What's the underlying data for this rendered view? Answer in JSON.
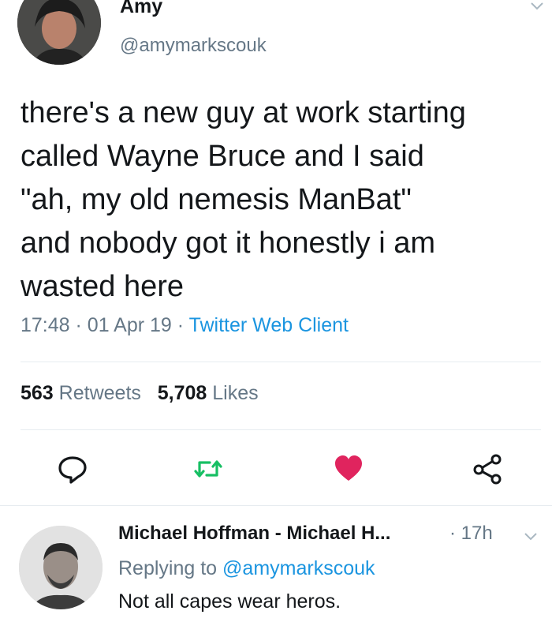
{
  "tweet": {
    "author_name": "Amy",
    "author_handle": "@amymarkscouk",
    "text": "there's a new guy at work starting\ncalled Wayne Bruce and I said\n\"ah, my old nemesis ManBat\"\nand nobody got it honestly i am\nwasted here",
    "time": "17:48",
    "date": "01 Apr 19",
    "client": "Twitter Web Client",
    "retweets_count": "563",
    "retweets_label": "Retweets",
    "likes_count": "5,708",
    "likes_label": "Likes"
  },
  "actions": {
    "reply_icon": "reply-icon",
    "retweet_icon": "retweet-icon",
    "like_icon": "heart-icon",
    "share_icon": "share-icon",
    "retweet_color": "#17bf63",
    "like_color": "#e0245e"
  },
  "reply": {
    "author_name": "Michael Hoffman - Michael H...",
    "time": "17h",
    "replying_to_label": "Replying to",
    "replying_to_handle": "@amymarkscouk",
    "text": "Not all capes wear heros."
  },
  "colors": {
    "text": "#14171a",
    "secondary": "#657786",
    "link": "#1b95e0"
  }
}
